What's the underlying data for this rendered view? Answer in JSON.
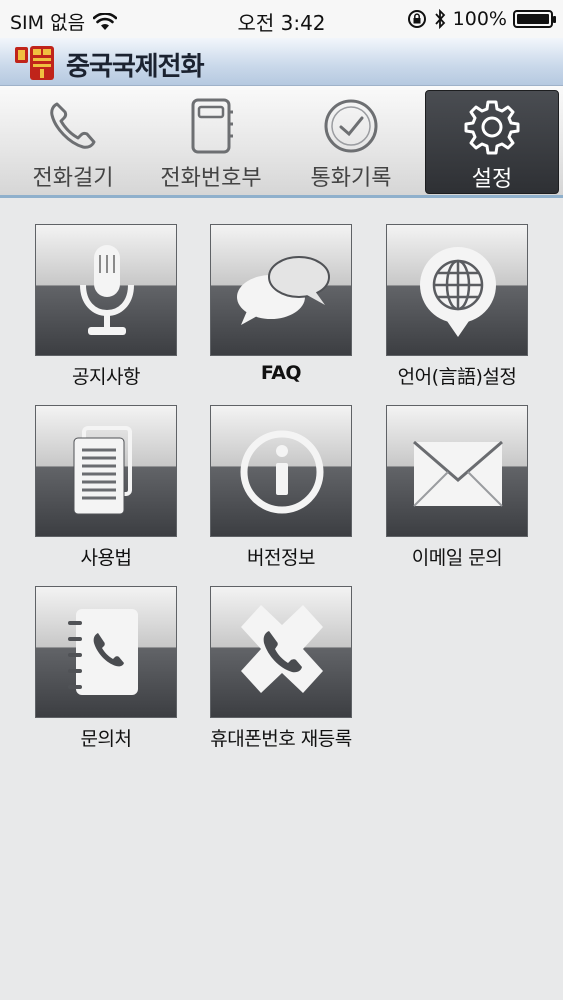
{
  "status_bar": {
    "carrier": "SIM 없음",
    "time": "오전 3:42",
    "battery": "100%",
    "battery_level": 1.0
  },
  "app": {
    "title": "중국국제전화"
  },
  "tabs": [
    {
      "label": "전화걸기",
      "icon": "phone-icon",
      "active": false
    },
    {
      "label": "전화번호부",
      "icon": "phonebook-icon",
      "active": false
    },
    {
      "label": "통화기록",
      "icon": "clock-icon",
      "active": false
    },
    {
      "label": "설정",
      "icon": "gear-icon",
      "active": true
    }
  ],
  "menu": [
    {
      "label": "공지사항",
      "icon": "microphone-icon"
    },
    {
      "label": "FAQ",
      "icon": "chat-bubbles-icon"
    },
    {
      "label": "언어(言語)설정",
      "icon": "globe-icon"
    },
    {
      "label": "사용법",
      "icon": "document-icon"
    },
    {
      "label": "버전정보",
      "icon": "info-icon"
    },
    {
      "label": "이메일 문의",
      "icon": "envelope-icon"
    },
    {
      "label": "문의처",
      "icon": "contact-book-icon"
    },
    {
      "label": "휴대폰번호 재등록",
      "icon": "phone-register-icon"
    }
  ],
  "colors": {
    "accent": "#8fb0cc",
    "active_tab": "#2e3034",
    "tile_dark": "#3c3e42"
  }
}
